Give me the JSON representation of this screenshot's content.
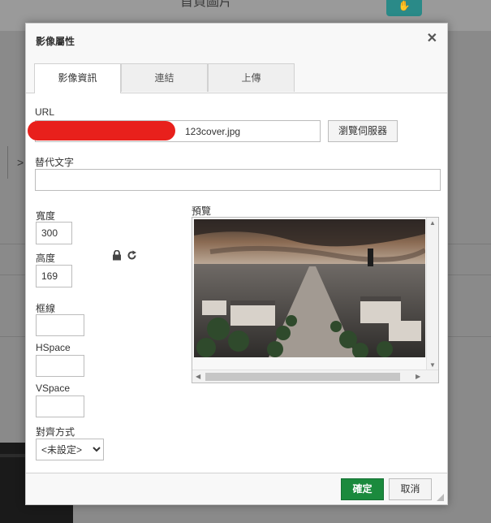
{
  "background": {
    "title": "首頁圖片",
    "chevron": ">"
  },
  "dialog": {
    "title": "影像屬性",
    "close_glyph": "✕",
    "tabs": [
      {
        "label": "影像資訊",
        "active": true
      },
      {
        "label": "連結",
        "active": false
      },
      {
        "label": "上傳",
        "active": false
      }
    ],
    "url_label": "URL",
    "url_value": "123cover.jpg",
    "browse_button": "瀏覽伺服器",
    "alt_label": "替代文字",
    "alt_value": "",
    "width_label": "寬度",
    "width_value": "300",
    "height_label": "高度",
    "height_value": "169",
    "border_label": "框線",
    "border_value": "",
    "hspace_label": "HSpace",
    "hspace_value": "",
    "vspace_label": "VSpace",
    "vspace_value": "",
    "align_label": "對齊方式",
    "align_value": "<未設定>",
    "preview_label": "預覽",
    "ok_button": "確定",
    "cancel_button": "取消",
    "icons": {
      "lock": "lock-icon",
      "reset": "reset-size-icon",
      "close": "close-icon"
    },
    "colors": {
      "ok": "#1b8a3d",
      "redaction": "#e8201c"
    }
  }
}
